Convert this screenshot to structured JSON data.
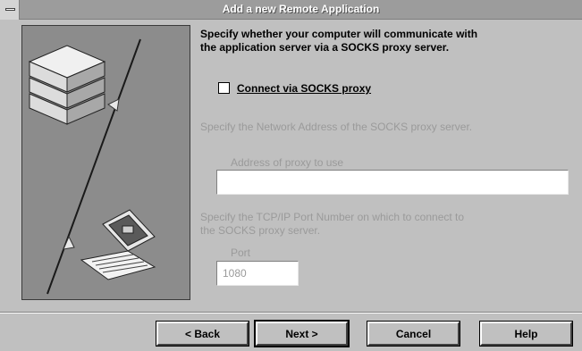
{
  "window": {
    "title": "Add a new Remote Application"
  },
  "intro": {
    "line1": "Specify whether your computer will communicate with",
    "line2": "the application server via a SOCKS proxy server."
  },
  "socks_checkbox": {
    "label": "Connect via SOCKS proxy",
    "checked": false
  },
  "address_section": {
    "description": "Specify the Network Address of the SOCKS proxy server.",
    "field_label": "Address of proxy to use",
    "value": ""
  },
  "port_section": {
    "description_line1": "Specify the TCP/IP Port Number on which to connect to",
    "description_line2": "the SOCKS proxy server.",
    "field_label": "Port",
    "value": "1080"
  },
  "buttons": {
    "back": "< Back",
    "next": "Next >",
    "cancel": "Cancel",
    "help": "Help"
  },
  "colors": {
    "dialog_bg": "#c0c0c0",
    "disabled_text": "#9a9a9a",
    "illustration_bg": "#8c8c8c"
  },
  "icons": [
    "system-menu-icon",
    "server-stack-icon",
    "laptop-icon"
  ]
}
